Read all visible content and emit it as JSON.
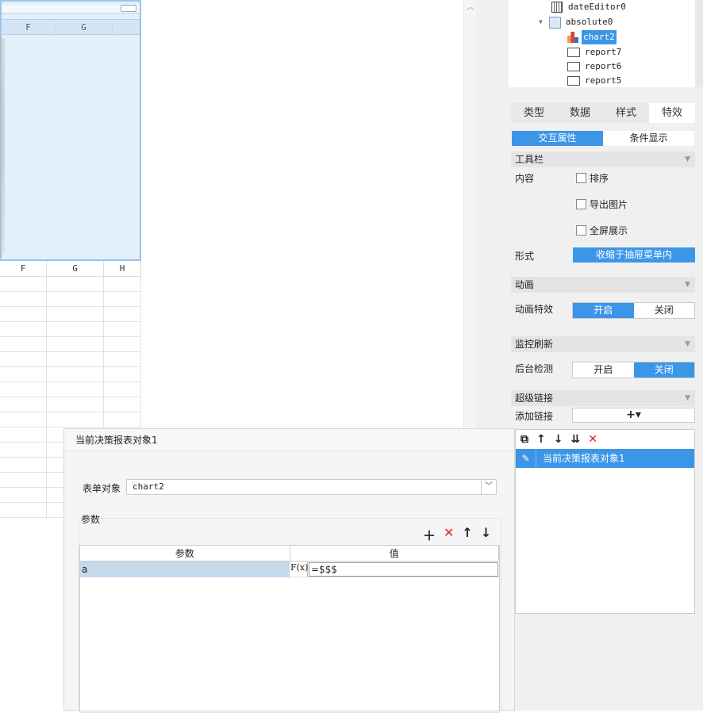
{
  "chart_widget": {
    "columns": [
      "F",
      "G"
    ]
  },
  "grid": {
    "columns": [
      "F",
      "G",
      "H"
    ]
  },
  "tree": {
    "items": [
      {
        "label": "dateEditor0",
        "icon": "calendar-icon",
        "selected": false
      },
      {
        "label": "absolute0",
        "icon": "absolute-layout-icon",
        "selected": false
      },
      {
        "label": "chart2",
        "icon": "chart-icon",
        "selected": true
      },
      {
        "label": "report7",
        "icon": "report-icon",
        "selected": false
      },
      {
        "label": "report6",
        "icon": "report-icon",
        "selected": false
      },
      {
        "label": "report5",
        "icon": "report-icon",
        "selected": false
      }
    ]
  },
  "tabs": [
    "类型",
    "数据",
    "样式",
    "特效"
  ],
  "active_tab": "特效",
  "subtabs": [
    "交互属性",
    "条件显示"
  ],
  "toolbar_section": {
    "title": "工具栏",
    "content_label": "内容",
    "options": [
      "排序",
      "导出图片",
      "全屏展示"
    ],
    "style_label": "形式",
    "style_value": "收缩于抽屉菜单内"
  },
  "animation_section": {
    "title": "动画",
    "label": "动画特效",
    "on": "开启",
    "off": "关闭",
    "selected": "开启"
  },
  "refresh_section": {
    "title": "监控刷新",
    "label": "后台检测",
    "on": "开启",
    "off": "关闭",
    "selected": "关闭"
  },
  "hyperlink_section": {
    "title": "超级链接",
    "add_label": "添加链接",
    "add_button": "+▾"
  },
  "link_list": {
    "items": [
      "当前决策报表对象1"
    ]
  },
  "dialog": {
    "title": "当前决策报表对象1",
    "form_label": "表单对象",
    "form_value": "chart2",
    "params_label": "参数",
    "table_headers": [
      "参数",
      "值"
    ],
    "rows": [
      {
        "name": "a",
        "fx": "F(x)",
        "value": "=$$$"
      }
    ]
  },
  "colors": {
    "accent": "#3c96e8",
    "delete": "#e02020"
  }
}
